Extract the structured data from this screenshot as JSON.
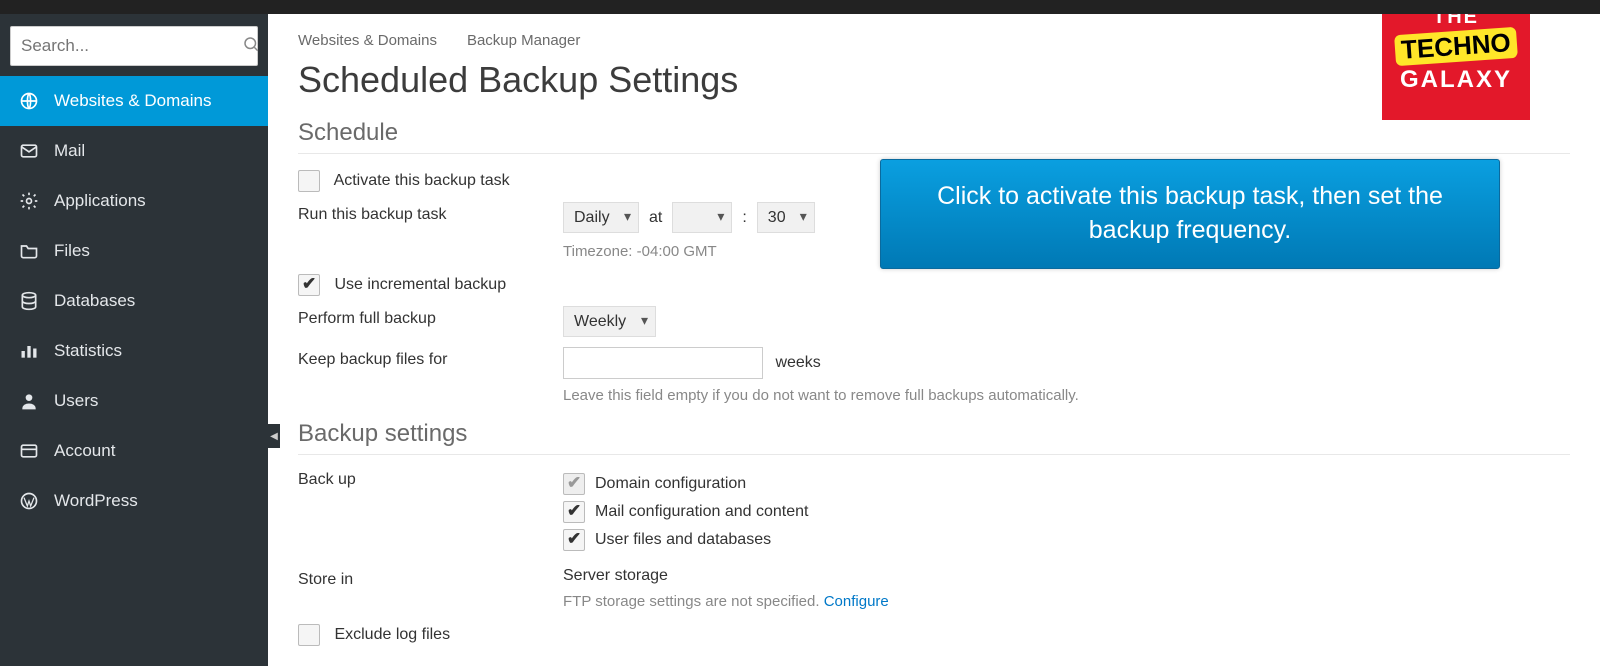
{
  "search": {
    "placeholder": "Search..."
  },
  "sidebar": {
    "items": [
      {
        "label": "Websites & Domains"
      },
      {
        "label": "Mail"
      },
      {
        "label": "Applications"
      },
      {
        "label": "Files"
      },
      {
        "label": "Databases"
      },
      {
        "label": "Statistics"
      },
      {
        "label": "Users"
      },
      {
        "label": "Account"
      },
      {
        "label": "WordPress"
      }
    ]
  },
  "breadcrumb": {
    "a": "Websites & Domains",
    "b": "Backup Manager"
  },
  "page_title": "Scheduled Backup Settings",
  "section_schedule": "Schedule",
  "activate_label": "Activate this backup task",
  "run_label": "Run this backup task",
  "run_freq": "Daily",
  "at_label": "at",
  "minute": "30",
  "time_sep": ":",
  "timezone": "Timezone: -04:00 GMT",
  "incremental_label": "Use incremental backup",
  "full_label": "Perform full backup",
  "full_freq": "Weekly",
  "keep_label": "Keep backup files for",
  "keep_unit": "weeks",
  "keep_hint": "Leave this field empty if you do not want to remove full backups automatically.",
  "section_settings": "Backup settings",
  "backup_label": "Back up",
  "chk_domain": "Domain configuration",
  "chk_mail": "Mail configuration and content",
  "chk_user": "User files and databases",
  "store_label": "Store in",
  "store_value": "Server storage",
  "store_hint_a": "FTP storage settings are not specified. ",
  "store_hint_b": "Configure",
  "exclude_label": "Exclude log files",
  "callout": "Click to activate this backup task, then set the backup frequency.",
  "logo": {
    "a": "THE",
    "b": "TECHNO",
    "c": "GALAXY"
  }
}
